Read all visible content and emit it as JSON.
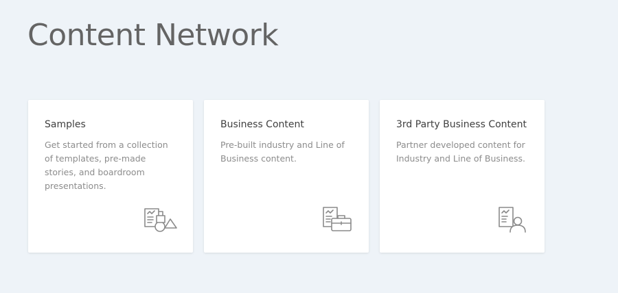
{
  "page": {
    "title": "Content Network"
  },
  "cards": [
    {
      "title": "Samples",
      "description": "Get started from a collection of templates, pre-made stories, and boardroom presentations.",
      "icon": "document-shapes-icon"
    },
    {
      "title": "Business Content",
      "description": "Pre-built industry and Line of Business content.",
      "icon": "document-briefcase-icon"
    },
    {
      "title": "3rd Party Business Content",
      "description": "Partner developed content for Industry and Line of Business.",
      "icon": "document-person-icon"
    }
  ],
  "colors": {
    "background": "#eef3f8",
    "card": "#ffffff",
    "title": "#646464",
    "icon": "#8a8a8a",
    "marker": "#e3e51d"
  }
}
